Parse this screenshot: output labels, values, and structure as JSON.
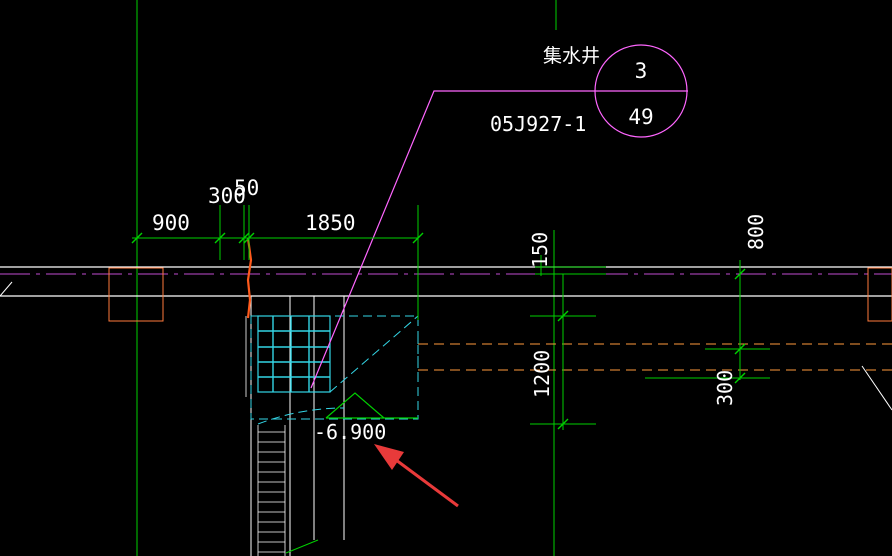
{
  "callout": {
    "name": "集水井",
    "number": "3",
    "sheet": "49",
    "atlas": "05J927-1"
  },
  "dimensions": {
    "d900": "900",
    "d300": "300",
    "d50": "50",
    "d1850": "1850",
    "d150": "150",
    "d800": "800",
    "d1200": "1200",
    "d300b": "300"
  },
  "elevation": {
    "value": "-6.900"
  },
  "colors": {
    "background": "#000000",
    "dimension": "#00d000",
    "wall": "#ffffff",
    "callout_leader": "#ff66ff",
    "pit": "#33d6e6",
    "hidden_line": "#ff9a3c",
    "column": "#ff7a3c",
    "arrow": "#e83a3a"
  }
}
